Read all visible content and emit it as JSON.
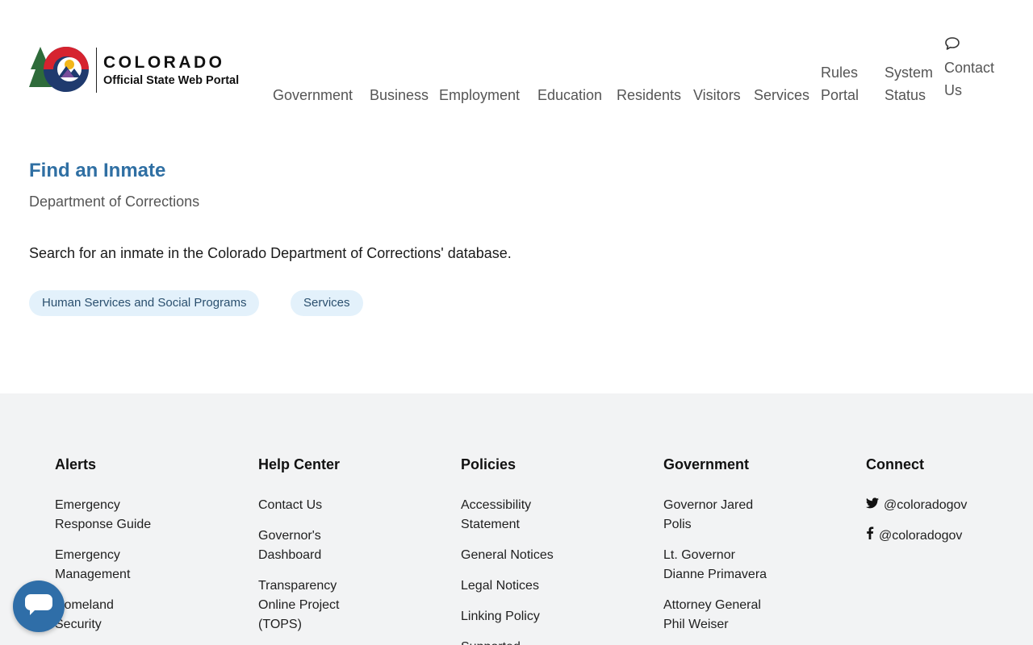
{
  "logo": {
    "title": "COLORADO",
    "subtitle": "Official State Web Portal"
  },
  "nav": {
    "items": [
      {
        "label": "Government"
      },
      {
        "label": "Business"
      },
      {
        "label": "Employment"
      },
      {
        "label": "Education"
      },
      {
        "label": "Residents"
      },
      {
        "label": "Visitors"
      },
      {
        "label": "Services"
      },
      {
        "label": "Rules",
        "label2": "Portal"
      },
      {
        "label": "System",
        "label2": "Status"
      },
      {
        "label": "Contact",
        "label2": "Us",
        "icon": "chat-icon"
      }
    ]
  },
  "page": {
    "title": "Find an Inmate",
    "subtitle": "Department of Corrections",
    "description": "Search for an inmate in the Colorado Department of Corrections' database.",
    "tags": [
      "Human Services and Social Programs",
      "Services"
    ]
  },
  "footer": {
    "columns": [
      {
        "heading": "Alerts",
        "links": [
          {
            "line1": "Emergency",
            "line2": "Response Guide"
          },
          {
            "line1": "Emergency",
            "line2": "Management"
          },
          {
            "line1": "Homeland",
            "line2": "Security"
          }
        ]
      },
      {
        "heading": "Help Center",
        "links": [
          {
            "line1": "Contact Us"
          },
          {
            "line1": "Governor's",
            "line2": "Dashboard"
          },
          {
            "line1": "Transparency",
            "line2": "Online Project",
            "line3": "(TOPS)"
          }
        ]
      },
      {
        "heading": "Policies",
        "links": [
          {
            "line1": "Accessibility",
            "line2": "Statement"
          },
          {
            "line1": "General Notices"
          },
          {
            "line1": "Legal Notices"
          },
          {
            "line1": "Linking Policy"
          },
          {
            "line1": "Supported"
          }
        ]
      },
      {
        "heading": "Government",
        "links": [
          {
            "line1": "Governor Jared",
            "line2": "Polis"
          },
          {
            "line1": "Lt. Governor",
            "line2": "Dianne Primavera"
          },
          {
            "line1": "Attorney General",
            "line2": "Phil Weiser"
          }
        ]
      },
      {
        "heading": "Connect",
        "social": [
          {
            "icon": "twitter-icon",
            "handle": "@coloradogov"
          },
          {
            "icon": "facebook-icon",
            "handle": "@coloradogov"
          }
        ]
      }
    ]
  },
  "colors": {
    "title_blue": "#2f6fa3",
    "tag_bg": "#e3f1fb",
    "footer_bg": "#f2f3f4",
    "chat_button": "#2f6ea8"
  }
}
